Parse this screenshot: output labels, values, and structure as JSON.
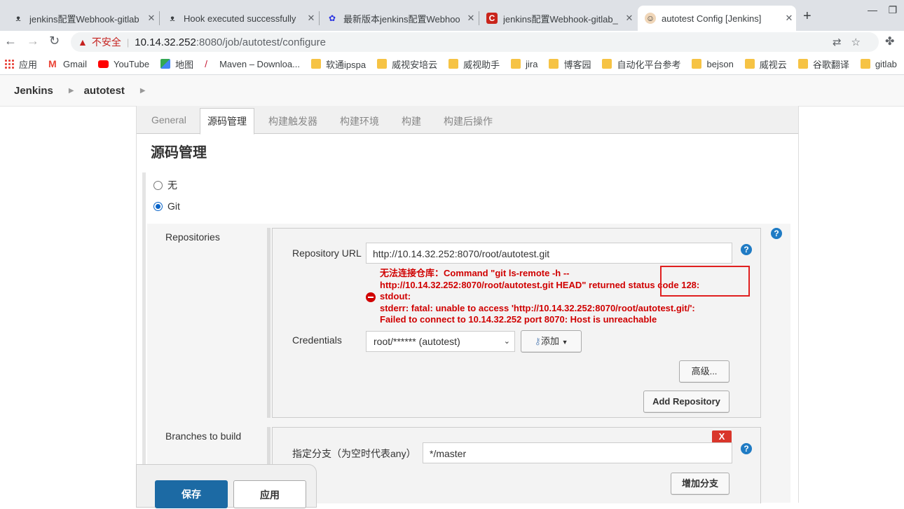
{
  "browser": {
    "tabs": [
      {
        "title": "jenkins配置Webhook-gitlab",
        "icon": "jenkins-favicon-icon"
      },
      {
        "title": "Hook executed successfully",
        "icon": "jenkins-favicon-icon"
      },
      {
        "title": "最新版本jenkins配置Webhoo",
        "icon": "baidu-paw-icon"
      },
      {
        "title": "jenkins配置Webhook-gitlab_",
        "icon": "csdn-c-icon"
      },
      {
        "title": "autotest Config [Jenkins]",
        "icon": "jenkins-butler-icon"
      }
    ],
    "not_secure": "不安全",
    "url_host": "10.14.32.252",
    "url_rest": ":8080/job/autotest/configure",
    "bookmarks": [
      {
        "label": "应用",
        "icon": "apps-grid-icon"
      },
      {
        "label": "Gmail",
        "icon": "gmail-icon"
      },
      {
        "label": "YouTube",
        "icon": "youtube-icon"
      },
      {
        "label": "地图",
        "icon": "maps-icon"
      },
      {
        "label": "Maven – Downloa...",
        "icon": "maven-feather-icon"
      },
      {
        "label": "软通ipspa",
        "icon": "folder-icon"
      },
      {
        "label": "威视安培云",
        "icon": "folder-icon"
      },
      {
        "label": "威视助手",
        "icon": "folder-icon"
      },
      {
        "label": "jira",
        "icon": "folder-icon"
      },
      {
        "label": "博客园",
        "icon": "folder-icon"
      },
      {
        "label": "自动化平台参考",
        "icon": "folder-icon"
      },
      {
        "label": "bejson",
        "icon": "folder-icon"
      },
      {
        "label": "威视云",
        "icon": "folder-icon"
      },
      {
        "label": "谷歌翻译",
        "icon": "folder-icon"
      },
      {
        "label": "gitlab",
        "icon": "folder-icon"
      }
    ]
  },
  "jenkins": {
    "breadcrumbs": [
      "Jenkins",
      "autotest"
    ],
    "config_tabs": [
      "General",
      "源码管理",
      "构建触发器",
      "构建环境",
      "构建",
      "构建后操作"
    ],
    "active_tab_index": 1,
    "section_title": "源码管理",
    "scm_options": {
      "none": "无",
      "git": "Git"
    },
    "selected_scm": "Git",
    "repositories_label": "Repositories",
    "repo_url_label": "Repository URL",
    "repo_url_value": "http://10.14.32.252:8070/root/autotest.git",
    "error_lines": [
      "无法连接仓库：Command \"git ls-remote -h --",
      "http://10.14.32.252:8070/root/autotest.git HEAD\" returned status code 128:",
      "stdout:",
      "stderr: fatal: unable to access 'http://10.14.32.252:8070/root/autotest.git/':",
      "Failed to connect to 10.14.32.252 port 8070: Host is unreachable"
    ],
    "credentials_label": "Credentials",
    "credentials_value": "root/****** (autotest)",
    "add_button": "添加",
    "advanced_button": "高级...",
    "add_repository_button": "Add Repository",
    "branches_label": "Branches to build",
    "branch_specifier_label": "指定分支（为空时代表any）",
    "branch_specifier_value": "*/master",
    "delete_button": "X",
    "add_branch_button": "增加分支",
    "save_button": "保存",
    "apply_button": "应用"
  },
  "colors": {
    "error": "#d00000",
    "highlight_box": "#e02020",
    "save_button": "#1c6aa4",
    "help_icon": "#1f7bc4"
  }
}
